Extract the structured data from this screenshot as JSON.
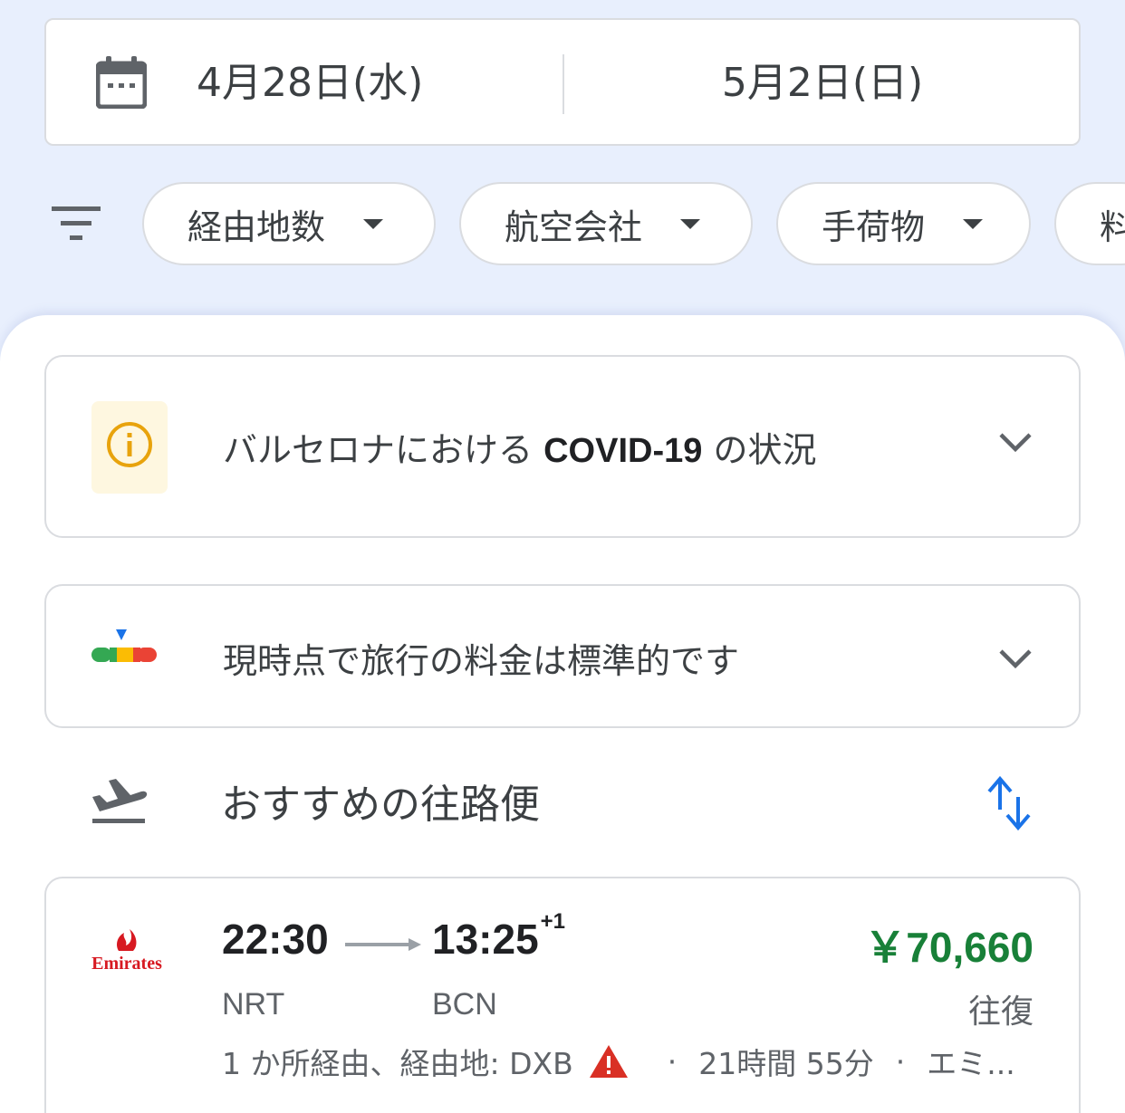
{
  "dates": {
    "departure": "4月28日(水)",
    "return": "5月2日(日)"
  },
  "filters": {
    "chips": [
      {
        "label": "経由地数"
      },
      {
        "label": "航空会社"
      },
      {
        "label": "手荷物"
      },
      {
        "label": "料"
      }
    ]
  },
  "covid_card": {
    "text_prefix": "バルセロナにおける ",
    "text_bold": "COVID-19",
    "text_suffix": " の状況"
  },
  "price_card": {
    "text": "現時点で旅行の料金は標準的です"
  },
  "section": {
    "title": "おすすめの往路便"
  },
  "flight": {
    "airline": "Emirates",
    "depart_time": "22:30",
    "arrive_time": "13:25",
    "day_offset": "+1",
    "price": "￥70,660",
    "depart_airport": "NRT",
    "arrive_airport": "BCN",
    "trip_type": "往復",
    "stops": "1 か所経由、経由地: DXB",
    "separator": "·",
    "duration": "21時間 55分",
    "carrier_short": "エミ..."
  },
  "colors": {
    "background": "#e8effd",
    "price_green": "#188038",
    "warning_red": "#d93025",
    "info_orange": "#e37400",
    "sort_blue": "#1a73e8"
  }
}
